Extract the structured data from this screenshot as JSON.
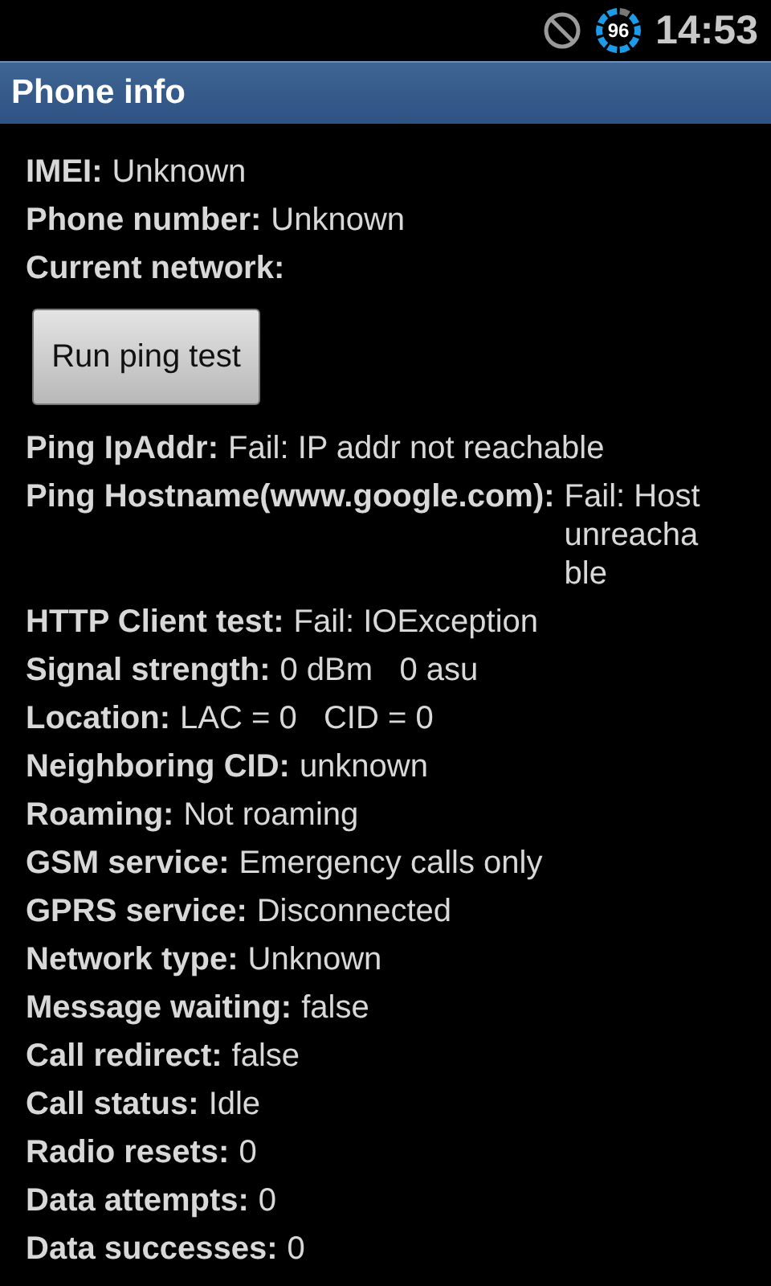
{
  "status_bar": {
    "battery": "96",
    "time": "14:53"
  },
  "title": "Phone info",
  "info_top": [
    {
      "label": "IMEI:",
      "value": "Unknown"
    },
    {
      "label": "Phone number:",
      "value": "Unknown"
    },
    {
      "label": "Current network:"
    }
  ],
  "button": "Run ping test",
  "info": [
    {
      "label": "Ping IpAddr:",
      "value": "Fail: IP addr not reachable"
    },
    {
      "label": "Ping Hostname(www.google.com):",
      "value": "Fail: Host unreachable"
    },
    {
      "label": "HTTP Client test:",
      "value": "Fail: IOException"
    },
    {
      "label": "Signal strength:",
      "value": "0 dBm   0 asu"
    },
    {
      "label": "Location:",
      "value": "LAC = 0   CID = 0"
    },
    {
      "label": "Neighboring CID:",
      "value": "unknown"
    },
    {
      "label": "Roaming:",
      "value": "Not roaming"
    },
    {
      "label": "GSM service:",
      "value": "Emergency calls only"
    },
    {
      "label": "GPRS service:",
      "value": "Disconnected"
    },
    {
      "label": "Network type:",
      "value": "Unknown"
    },
    {
      "label": "Message waiting:",
      "value": "false"
    },
    {
      "label": "Call redirect:",
      "value": "false"
    },
    {
      "label": "Call status:",
      "value": "Idle"
    },
    {
      "label": "Radio resets:",
      "value": "0"
    },
    {
      "label": "Data attempts:",
      "value": "0"
    },
    {
      "label": "Data successes:",
      "value": "0"
    }
  ]
}
